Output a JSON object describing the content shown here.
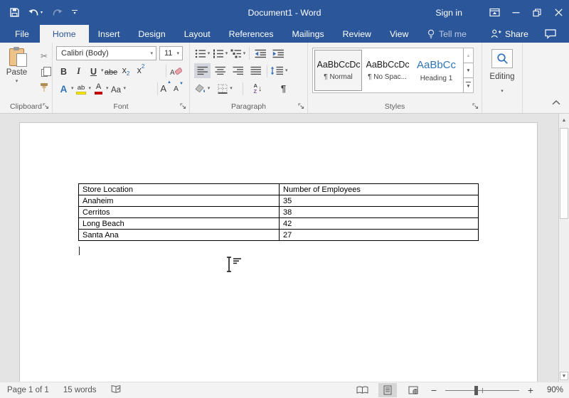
{
  "titlebar": {
    "title": "Document1 - Word",
    "sign_in": "Sign in"
  },
  "tabs": [
    "File",
    "Home",
    "Insert",
    "Design",
    "Layout",
    "References",
    "Mailings",
    "Review",
    "View"
  ],
  "tab_extras": {
    "tell_me": "Tell me",
    "share": "Share"
  },
  "icons": {
    "dropdown": "▾",
    "up_arrow": "▲",
    "down_arrow": "▼",
    "scissors": "✂",
    "arrow_down": "↓"
  },
  "ribbon": {
    "clipboard": {
      "label": "Clipboard",
      "paste": "Paste"
    },
    "font": {
      "label": "Font",
      "name": "Calibri (Body)",
      "size": "11",
      "bold": "B",
      "italic": "I",
      "underline": "U",
      "strikethrough": "abe",
      "sub_base": "x",
      "sub_mark": "2",
      "sup_base": "x",
      "sup_mark": "2",
      "clear": "A",
      "effects": "A",
      "highlight": "ab",
      "color": "A",
      "change_case": "Aa",
      "grow": "A",
      "shrink": "A"
    },
    "paragraph": {
      "label": "Paragraph",
      "pilcrow": "¶",
      "sort_a": "A",
      "sort_z": "Z"
    },
    "styles": {
      "label": "Styles",
      "items": [
        {
          "preview": "AaBbCcDc",
          "name": "¶ Normal"
        },
        {
          "preview": "AaBbCcDc",
          "name": "¶ No Spac..."
        },
        {
          "preview": "AaBbCc",
          "name": "Heading 1"
        }
      ]
    },
    "editing": {
      "label": "Editing"
    }
  },
  "document": {
    "table": {
      "headers": [
        "Store Location",
        "Number of Employees"
      ],
      "rows": [
        [
          "Anaheim",
          "35"
        ],
        [
          "Cerritos",
          "38"
        ],
        [
          "Long Beach",
          "42"
        ],
        [
          "Santa Ana",
          "27"
        ]
      ]
    }
  },
  "statusbar": {
    "page": "Page 1 of 1",
    "words": "15 words",
    "zoom": "90%",
    "zoom_out": "−",
    "zoom_in": "+"
  },
  "colors": {
    "titlebar": "#2b579a",
    "accent": "#2b579a",
    "heading_style": "#2e74b5",
    "highlight_yellow": "#fdee00",
    "font_color_red": "#c00000"
  }
}
